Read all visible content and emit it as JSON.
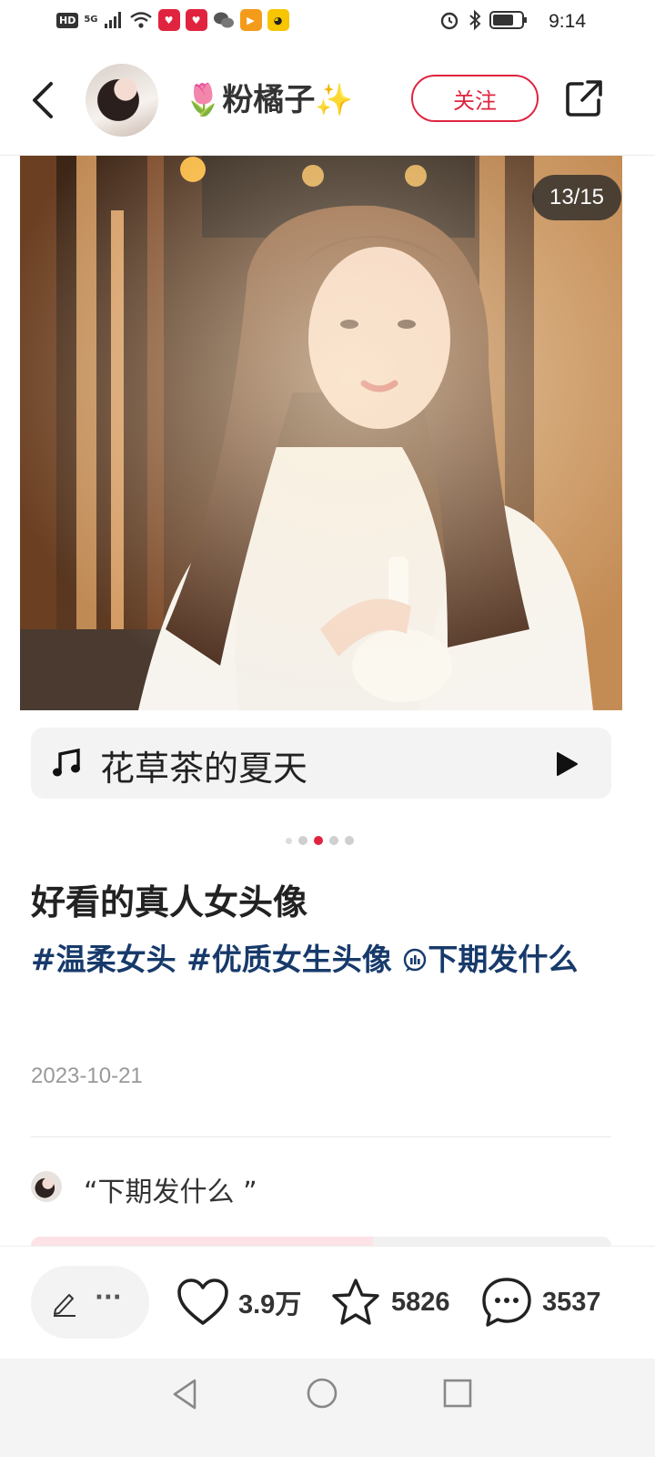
{
  "status_bar": {
    "network_left": "HD",
    "network_type": "5G",
    "time": "9:14"
  },
  "header": {
    "author_name": "🌷粉橘子✨",
    "follow_label": "关注"
  },
  "photo": {
    "page_counter": "13/15"
  },
  "music": {
    "title": "花草茶的夏天"
  },
  "post": {
    "title": "好看的真人女头像",
    "tags": [
      "#温柔女头",
      "#优质女生头像",
      "下期发什么"
    ],
    "date": "2023-10-21"
  },
  "poll": {
    "question": "“下期发什么 ”"
  },
  "actions": {
    "likes": "3.9万",
    "collects": "5826",
    "comments": "3537",
    "more": "···"
  },
  "colors": {
    "accent": "#e0243f",
    "tag": "#173a6b"
  }
}
